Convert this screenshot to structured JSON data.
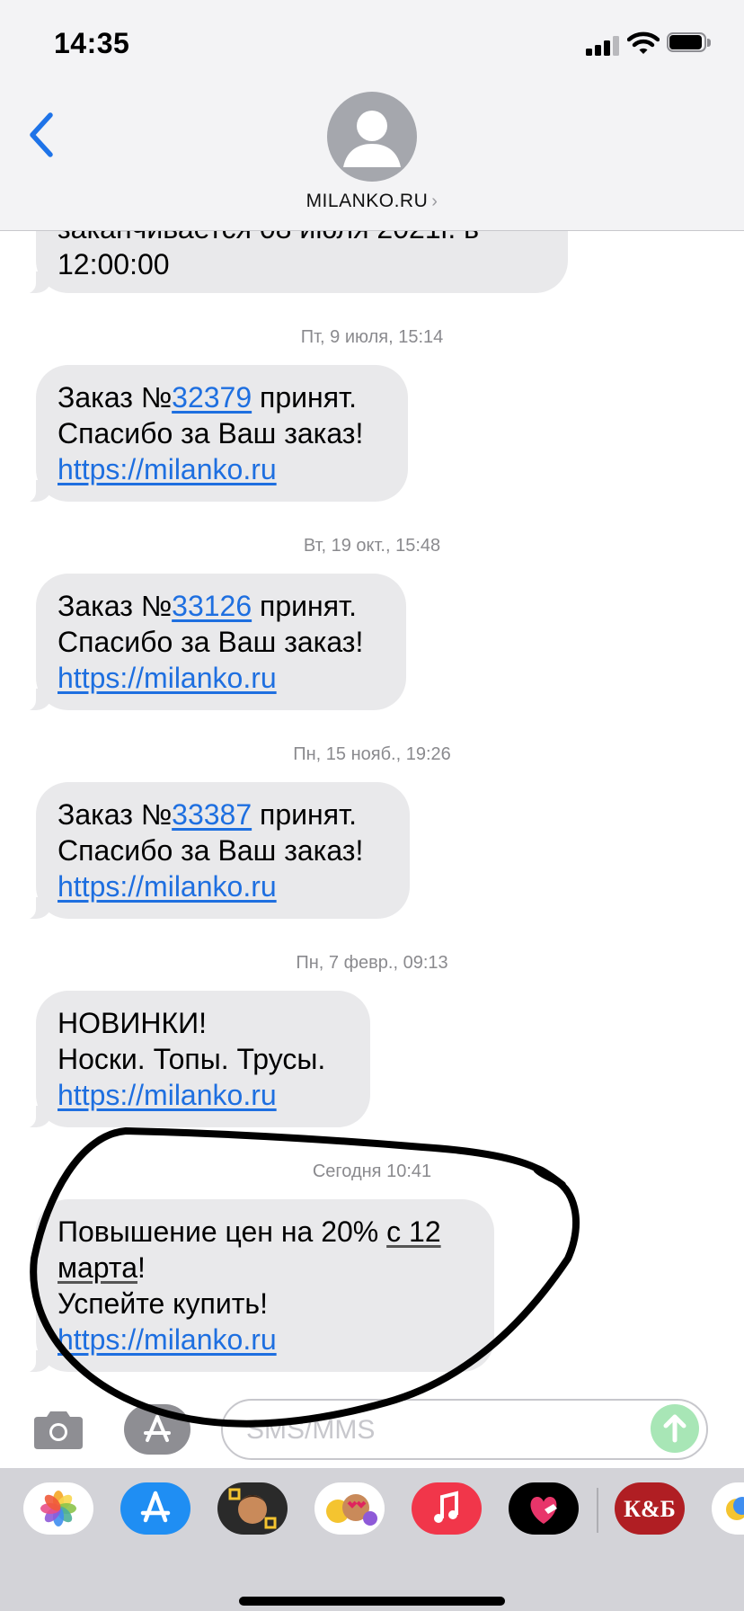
{
  "status_bar": {
    "time": "14:35"
  },
  "header": {
    "contact_name": "MILANKO.RU",
    "chevron": "›"
  },
  "messages": [
    {
      "lines": [
        "заканчивается 08 июля 2021г. в",
        "12:00:00"
      ]
    },
    {
      "timestamp": "Пт, 9 июля, 15:14",
      "order_prefix": "Заказ №",
      "order_number": "32379",
      "order_suffix": " принят.",
      "line2": "Спасибо за Ваш заказ!",
      "link": "https://milanko.ru"
    },
    {
      "timestamp": "Вт, 19 окт., 15:48",
      "order_prefix": "Заказ №",
      "order_number": "33126",
      "order_suffix": " принят.",
      "line2": "Спасибо за Ваш заказ!",
      "link": "https://milanko.ru"
    },
    {
      "timestamp": "Пн, 15 нояб., 19:26",
      "order_prefix": "Заказ №",
      "order_number": "33387",
      "order_suffix": " принят.",
      "line2": "Спасибо за Ваш заказ!",
      "link": "https://milanko.ru"
    },
    {
      "timestamp": "Пн, 7 февр., 09:13",
      "line1": "НОВИНКИ!",
      "line2": "Носки. Топы. Трусы.",
      "link": "https://milanko.ru"
    },
    {
      "timestamp": "Сегодня 10:41",
      "line1_text": "Повышение цен на 20% ",
      "line1_date": "с 12",
      "line2_date": "марта",
      "line2_end": "!",
      "line3": "Успейте купить!",
      "link": "https://milanko.ru"
    }
  ],
  "input": {
    "placeholder": "SMS/MMS"
  },
  "app_drawer": {
    "apps": [
      "photos-icon",
      "app-store-icon",
      "memoji-icon",
      "animoji-stickers-icon",
      "music-icon",
      "digital-touch-icon",
      "kb-store-icon",
      "partial-app-icon"
    ],
    "kb_label": "К&Б"
  },
  "colors": {
    "bubble": "#e9e9eb",
    "link": "#1e6fe0",
    "header": "#f3f3f5",
    "drawer": "#d3d3d8",
    "annotation": "#000000"
  }
}
